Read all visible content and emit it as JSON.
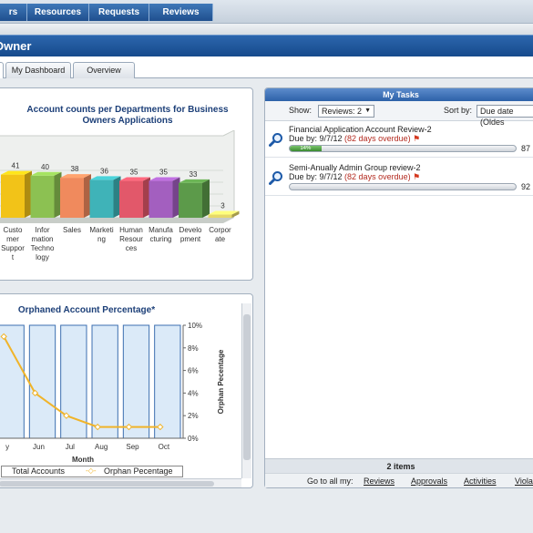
{
  "topnav": {
    "items": [
      "rs",
      "Resources",
      "Requests",
      "Reviews"
    ]
  },
  "header": {
    "title": "Owner"
  },
  "tabs": [
    "",
    "My Dashboard",
    "Overview"
  ],
  "bar_panel": {
    "title_line1": "Account counts per Departments for Business",
    "title_line2": "Owners Applications"
  },
  "line_panel": {
    "title": "Orphaned Account Percentage*",
    "legend": [
      "Total Accounts",
      "Orphan Pecentage"
    ]
  },
  "mytasks": {
    "title": "My Tasks",
    "show_label": "Show:",
    "show_value": "Reviews: 2",
    "sort_label": "Sort by:",
    "sort_value": "Due date (Oldes",
    "tasks": [
      {
        "name": "Financial Application Account Review-2",
        "due_prefix": "Due by: 9/7/12 ",
        "overdue": "(82 days overdue)",
        "percent_label": "14%",
        "count": "87",
        "progress": 0.14
      },
      {
        "name": "Semi-Anually Admin Group review-2",
        "due_prefix": "Due by: 9/7/12 ",
        "overdue": "(82 days overdue)",
        "percent_label": "",
        "count": "92",
        "progress": 0.0
      }
    ],
    "items_count": "2 items",
    "goto_label": "Go to all my:",
    "links": [
      "Reviews",
      "Approvals",
      "Activities",
      "Violat"
    ]
  },
  "chart_data": [
    {
      "type": "bar",
      "title": "Account counts per Departments for Business Owners Applications",
      "categories": [
        "Custo mer Suppor t",
        "Infor mation Techno logy",
        "Sales",
        "Marketi ng",
        "Human Resour ces",
        "Manufa cturing",
        "Develo pment",
        "Corpor ate"
      ],
      "values": [
        41,
        40,
        38,
        36,
        35,
        35,
        33,
        3
      ],
      "colors": [
        "#f2c318",
        "#8cc152",
        "#f08a5d",
        "#3fb3b8",
        "#e2586a",
        "#a35fbf",
        "#5c9a4a",
        "#e6d96a"
      ]
    },
    {
      "type": "line",
      "title": "Orphaned Account Percentage*",
      "categories": [
        "y",
        "Jun",
        "Jul",
        "Aug",
        "Sep",
        "Oct"
      ],
      "xlabel": "Month",
      "ylabel": "Orphan Pecentage",
      "ylim": [
        0,
        10
      ],
      "y_ticks": [
        "10%",
        "8%",
        "6%",
        "4%",
        "2%",
        "0%"
      ],
      "series": [
        {
          "name": "Total Accounts",
          "type": "bar",
          "values": [
            10,
            10,
            10,
            10,
            10,
            10
          ]
        },
        {
          "name": "Orphan Pecentage",
          "type": "line",
          "values": [
            9,
            4,
            2,
            1,
            1,
            1
          ]
        }
      ]
    }
  ]
}
